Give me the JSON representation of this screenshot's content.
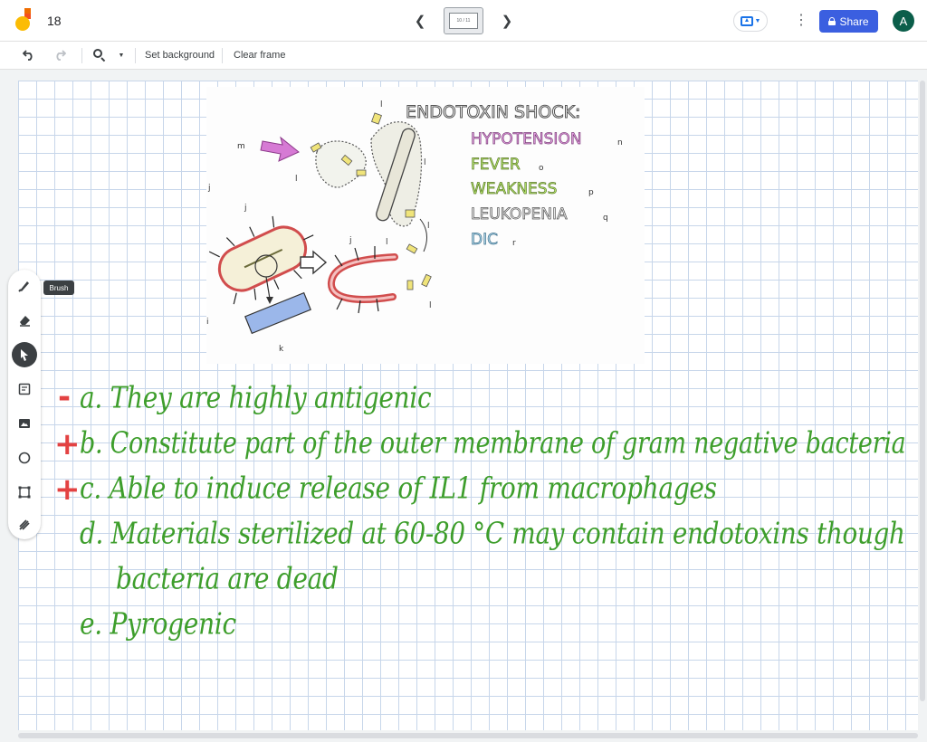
{
  "header": {
    "title": "18",
    "frame_indicator": "10 / 11",
    "share_label": "Share",
    "avatar_initial": "A"
  },
  "toolbar": {
    "set_background": "Set background",
    "clear_frame": "Clear frame"
  },
  "tools": {
    "tooltip": "Brush",
    "items": [
      "pen-icon",
      "eraser-icon",
      "select-arrow-icon",
      "sticky-note-icon",
      "image-icon",
      "circle-icon",
      "textbox-icon",
      "laser-icon"
    ]
  },
  "image_figure": {
    "title": "ENDOTOXIN SHOCK:",
    "symptoms": [
      {
        "label": "HYPOTENSION",
        "letter": "n",
        "color": "#d877d4"
      },
      {
        "label": "FEVER",
        "letter": "o",
        "color": "#a6e05a"
      },
      {
        "label": "WEAKNESS",
        "letter": "p",
        "color": "#a6e05a"
      },
      {
        "label": "LEUKOPENIA",
        "letter": "q",
        "color": "#dddddd"
      },
      {
        "label": "DIC",
        "letter": "r",
        "color": "#9fd0ea"
      }
    ],
    "letters": {
      "j": "j",
      "k": "k",
      "l": "l",
      "m": "m",
      "i": "i"
    }
  },
  "notes": {
    "marks": [
      "-",
      "+",
      "+"
    ],
    "lines": [
      "a. They are highly antigenic",
      "b. Constitute part of the outer membrane of gram negative bacteria",
      "c. Able to induce release of IL1 from macrophages",
      "d. Materials sterilized at 60-80 °C may contain endotoxins though",
      "bacteria are dead",
      "e. Pyrogenic"
    ]
  },
  "colors": {
    "share": "#3b5fe0",
    "avatar": "#0b5e4a",
    "handwriting": "#3e9e2c",
    "marks": "#e34242",
    "grid": "#c7d6ea"
  }
}
